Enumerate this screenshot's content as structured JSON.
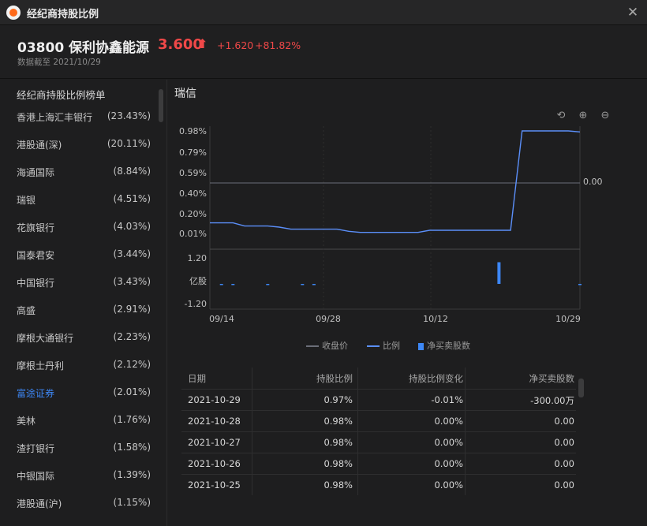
{
  "window": {
    "title": "经纪商持股比例",
    "close_glyph": "✕"
  },
  "stock": {
    "code_name": "03800 保利协鑫能源",
    "price": "3.600",
    "price_arrow": "⬆",
    "change": "+1.620",
    "change_pct": "+81.82%",
    "as_of": "数据截至 2021/10/29",
    "up_color": "#f04848"
  },
  "sidebar": {
    "title": "经纪商持股比例榜单",
    "items": [
      {
        "name": "香港上海汇丰银行",
        "pct": "(23.43%)"
      },
      {
        "name": "港股通(深)",
        "pct": "(20.11%)"
      },
      {
        "name": "海通国际",
        "pct": "(8.84%)"
      },
      {
        "name": "瑞银",
        "pct": "(4.51%)"
      },
      {
        "name": "花旗银行",
        "pct": "(4.03%)"
      },
      {
        "name": "国泰君安",
        "pct": "(3.44%)"
      },
      {
        "name": "中国银行",
        "pct": "(3.43%)"
      },
      {
        "name": "高盛",
        "pct": "(2.91%)"
      },
      {
        "name": "摩根大通银行",
        "pct": "(2.23%)"
      },
      {
        "name": "摩根士丹利",
        "pct": "(2.12%)"
      },
      {
        "name": "富途证券",
        "pct": "(2.01%)"
      },
      {
        "name": "美林",
        "pct": "(1.76%)"
      },
      {
        "name": "渣打银行",
        "pct": "(1.58%)"
      },
      {
        "name": "中银国际",
        "pct": "(1.39%)"
      },
      {
        "name": "港股通(沪)",
        "pct": "(1.15%)"
      }
    ],
    "active_index": 10,
    "accent_color": "#3d87f5"
  },
  "main": {
    "broker_title": "瑞信",
    "tools": [
      {
        "icon": "reset-icon",
        "glyph": "⟲"
      },
      {
        "icon": "zoom-in-icon",
        "glyph": "⊕"
      },
      {
        "icon": "zoom-out-icon",
        "glyph": "⊖"
      }
    ]
  },
  "chart_data": {
    "type": "line",
    "title": "",
    "x_ticks": [
      "09/14",
      "09/28",
      "10/12",
      "10/29"
    ],
    "y_ticks": [
      "0.98%",
      "0.79%",
      "0.59%",
      "0.40%",
      "0.20%",
      "0.01%"
    ],
    "right_axis_label": "0.00",
    "bar_axis": {
      "top": "1.20",
      "unit": "亿股",
      "bottom": "-1.20"
    },
    "series": [
      {
        "name": "比例",
        "color": "#5b8ff9",
        "x": [
          "09/13",
          "09/14",
          "09/15",
          "09/16",
          "09/17",
          "09/20",
          "09/21",
          "09/22",
          "09/23",
          "09/24",
          "09/27",
          "09/28",
          "09/29",
          "09/30",
          "10/04",
          "10/05",
          "10/06",
          "10/07",
          "10/08",
          "10/11",
          "10/12",
          "10/13",
          "10/15",
          "10/18",
          "10/19",
          "10/20",
          "10/21",
          "10/22",
          "10/25",
          "10/26",
          "10/27",
          "10/28",
          "10/29"
        ],
        "values": [
          0.11,
          0.11,
          0.11,
          0.08,
          0.08,
          0.08,
          0.07,
          0.05,
          0.05,
          0.05,
          0.05,
          0.05,
          0.03,
          0.02,
          0.02,
          0.02,
          0.02,
          0.02,
          0.02,
          0.04,
          0.04,
          0.04,
          0.04,
          0.04,
          0.04,
          0.04,
          0.04,
          0.98,
          0.98,
          0.98,
          0.98,
          0.98,
          0.97
        ]
      },
      {
        "name": "净买卖股数",
        "color": "#3d87f5",
        "unit": "亿股",
        "x": [
          "09/13",
          "09/14",
          "09/15",
          "09/16",
          "09/17",
          "09/20",
          "09/21",
          "09/22",
          "09/23",
          "09/24",
          "09/27",
          "09/28",
          "09/29",
          "09/30",
          "10/04",
          "10/05",
          "10/06",
          "10/07",
          "10/08",
          "10/11",
          "10/12",
          "10/13",
          "10/15",
          "10/18",
          "10/19",
          "10/20",
          "10/21",
          "10/22",
          "10/25",
          "10/26",
          "10/27",
          "10/28",
          "10/29"
        ],
        "values": [
          0,
          -0.03,
          -0.03,
          0,
          0,
          -0.03,
          0,
          0,
          -0.03,
          -0.03,
          0,
          0,
          0,
          0,
          0,
          0,
          0,
          0,
          0,
          0,
          0,
          0,
          0,
          0,
          0,
          1.0,
          0,
          0,
          0,
          0,
          0,
          0,
          -0.03
        ]
      }
    ],
    "legend": [
      {
        "name": "收盘价",
        "color": "#6b6e78"
      },
      {
        "name": "比例",
        "color": "#5b8ff9"
      },
      {
        "name": "净买卖股数",
        "color": "#3d87f5"
      }
    ],
    "grid": true,
    "legend_position": "bottom"
  },
  "table": {
    "headers": [
      "日期",
      "持股比例",
      "持股比例变化",
      "净买卖股数"
    ],
    "rows": [
      [
        "2021-10-29",
        "0.97%",
        "-0.01%",
        "-300.00万"
      ],
      [
        "2021-10-28",
        "0.98%",
        "0.00%",
        "0.00"
      ],
      [
        "2021-10-27",
        "0.98%",
        "0.00%",
        "0.00"
      ],
      [
        "2021-10-26",
        "0.98%",
        "0.00%",
        "0.00"
      ],
      [
        "2021-10-25",
        "0.98%",
        "0.00%",
        "0.00"
      ]
    ]
  }
}
